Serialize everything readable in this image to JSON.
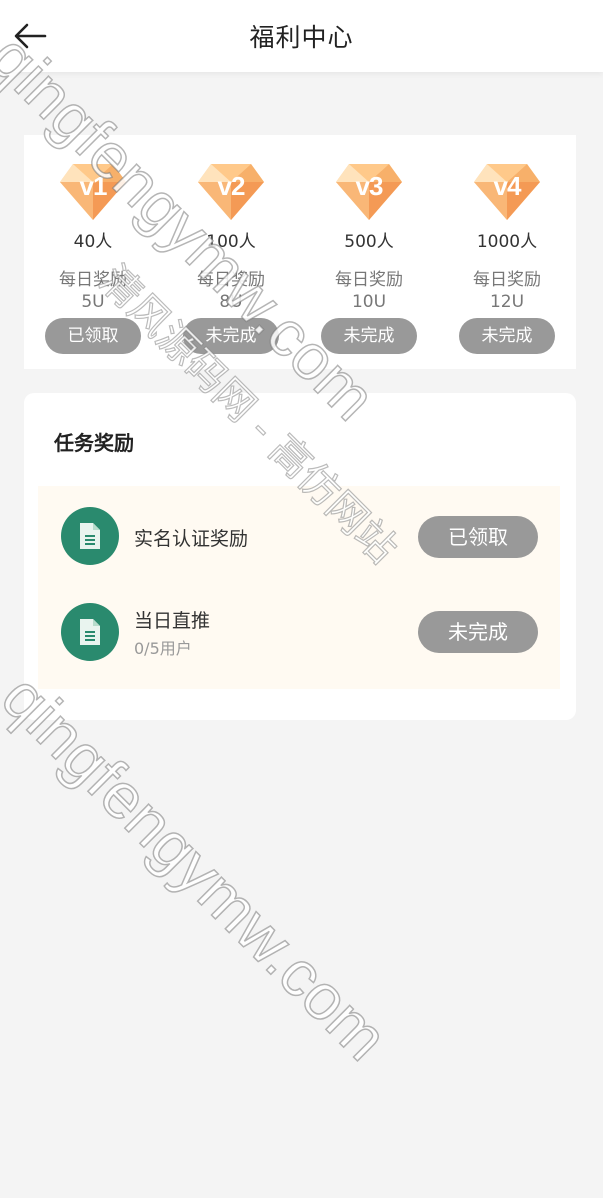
{
  "header": {
    "title": "福利中心",
    "back_icon": "arrow-left-icon"
  },
  "vip_levels": [
    {
      "level": "v1",
      "count": "40人",
      "daily_label": "每日奖励",
      "amount": "5U",
      "status": "已领取"
    },
    {
      "level": "v2",
      "count": "100人",
      "daily_label": "每日奖励",
      "amount": "8U",
      "status": "未完成"
    },
    {
      "level": "v3",
      "count": "500人",
      "daily_label": "每日奖励",
      "amount": "10U",
      "status": "未完成"
    },
    {
      "level": "v4",
      "count": "1000人",
      "daily_label": "每日奖励",
      "amount": "12U",
      "status": "未完成"
    }
  ],
  "tasks": {
    "title": "任务奖励",
    "items": [
      {
        "name": "实名认证奖励",
        "sub": "",
        "status": "已领取",
        "icon": "document-icon"
      },
      {
        "name": "当日直推",
        "sub": "0/5用户",
        "status": "未完成",
        "icon": "document-icon"
      }
    ]
  },
  "watermark": {
    "line1": "qingfengymw.com",
    "line2": "qingfengymw.com",
    "cn": "清风源码网 - 高仿网站"
  },
  "colors": {
    "background": "#f4f4f4",
    "diamond_light": "#ffd49a",
    "diamond_dark": "#f49a55",
    "button_gray": "#999999",
    "task_icon_green": "#2a8a6e",
    "task_list_bg": "#fffaf2"
  }
}
